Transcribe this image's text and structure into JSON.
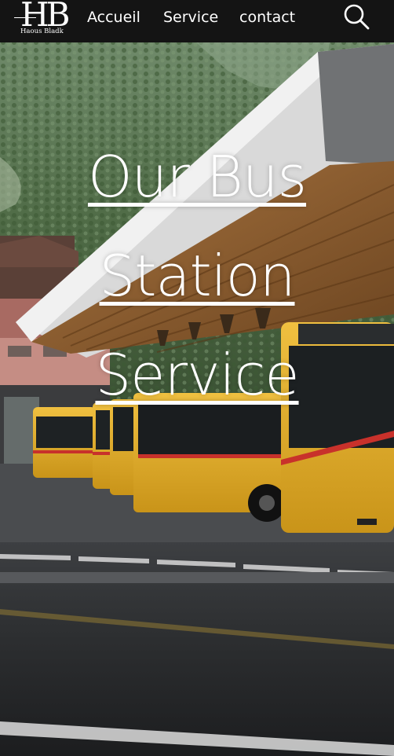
{
  "brand": {
    "logo_mark": "HB",
    "logo_subtitle": "Haous Bladk"
  },
  "nav": {
    "links": [
      "Accueil",
      "Service",
      "contact"
    ],
    "search_icon": "search-icon"
  },
  "hero": {
    "title_lines": [
      "Our Bus",
      "Station",
      "Service"
    ]
  },
  "colors": {
    "navbar_bg": "#141414",
    "text": "#ffffff",
    "bus_yellow": "#e4b22a",
    "bus_red_stripe": "#c8312b"
  }
}
